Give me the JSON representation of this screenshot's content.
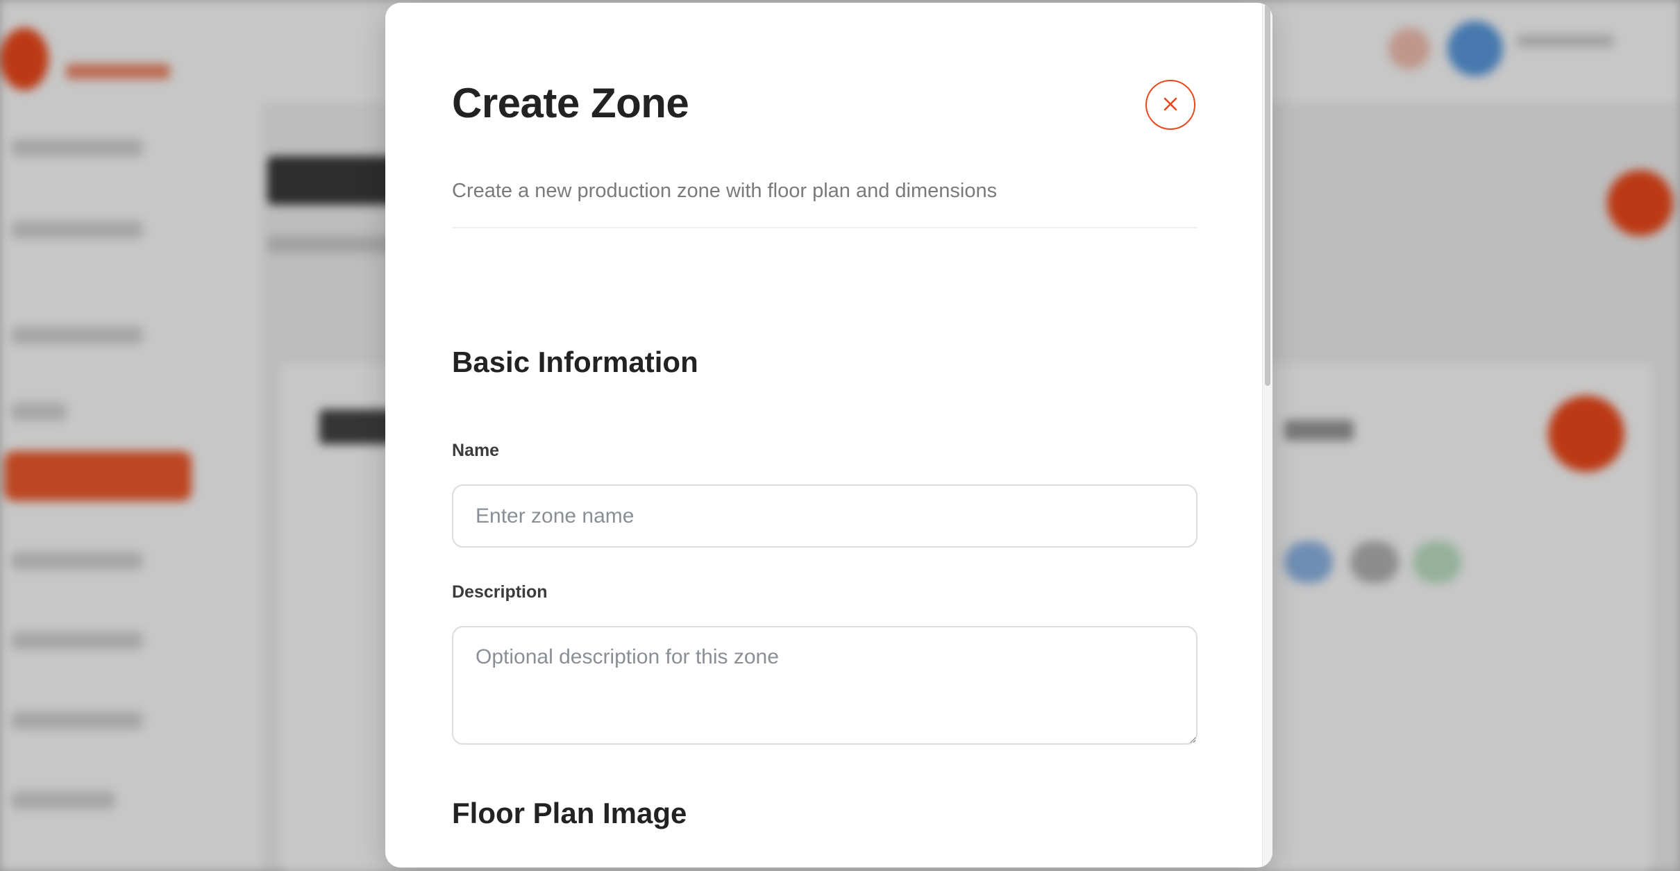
{
  "modal": {
    "title": "Create Zone",
    "subtitle": "Create a new production zone with floor plan and dimensions",
    "close_icon": "close-icon",
    "accent_color": "#e9471c"
  },
  "sections": {
    "basic_info": {
      "heading": "Basic Information",
      "name_label": "Name",
      "name_placeholder": "Enter zone name",
      "name_value": "",
      "description_label": "Description",
      "description_placeholder": "Optional description for this zone",
      "description_value": ""
    },
    "floor_plan": {
      "heading": "Floor Plan Image"
    }
  }
}
